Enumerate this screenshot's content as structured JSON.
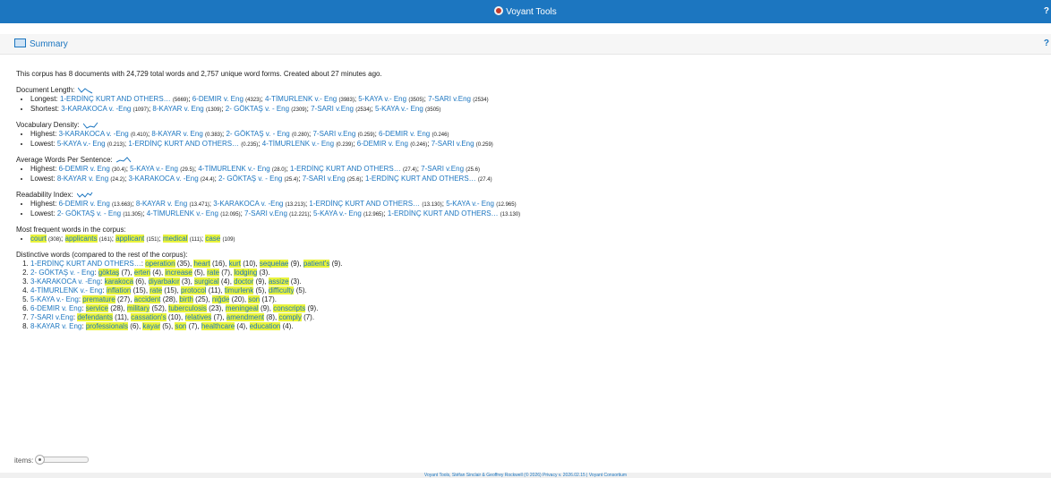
{
  "app": {
    "title": "Voyant Tools",
    "help": "?"
  },
  "panel": {
    "title": "Summary",
    "help": "?"
  },
  "summary": {
    "intro": "This corpus has 8 documents with 24,729 total words and 2,757 unique word forms. Created about 27 minutes ago.",
    "doc_length": {
      "label": "Document Length:",
      "longest_label": "Longest:",
      "longest": [
        {
          "name": "1-ERDİNÇ KURT AND OTHERS…",
          "value": "(5669)"
        },
        {
          "name": "6-DEMIR v. Eng",
          "value": "(4323)"
        },
        {
          "name": "4-TİMURLENK v.- Eng",
          "value": "(3983)"
        },
        {
          "name": "5-KAYA v.- Eng",
          "value": "(3505)"
        },
        {
          "name": "7-SARI v.Eng",
          "value": "(2534)"
        }
      ],
      "shortest_label": "Shortest:",
      "shortest": [
        {
          "name": "3-KARAKOCA v. -Eng",
          "value": "(1097)"
        },
        {
          "name": "8-KAYAR v. Eng",
          "value": "(1309)"
        },
        {
          "name": "2- GÖKTAŞ v. - Eng",
          "value": "(2309)"
        },
        {
          "name": "7-SARI v.Eng",
          "value": "(2534)"
        },
        {
          "name": "5-KAYA v.- Eng",
          "value": "(3505)"
        }
      ]
    },
    "vocab_density": {
      "label": "Vocabulary Density:",
      "highest_label": "Highest:",
      "highest": [
        {
          "name": "3-KARAKOCA v. -Eng",
          "value": "(0.410)"
        },
        {
          "name": "8-KAYAR v. Eng",
          "value": "(0.383)"
        },
        {
          "name": "2- GÖKTAŞ v. - Eng",
          "value": "(0.280)"
        },
        {
          "name": "7-SARI v.Eng",
          "value": "(0.259)"
        },
        {
          "name": "6-DEMIR v. Eng",
          "value": "(0.246)"
        }
      ],
      "lowest_label": "Lowest:",
      "lowest": [
        {
          "name": "5-KAYA v.- Eng",
          "value": "(0.213)"
        },
        {
          "name": "1-ERDİNÇ KURT AND OTHERS…",
          "value": "(0.235)"
        },
        {
          "name": "4-TİMURLENK v.- Eng",
          "value": "(0.239)"
        },
        {
          "name": "6-DEMIR v. Eng",
          "value": "(0.246)"
        },
        {
          "name": "7-SARI v.Eng",
          "value": "(0.259)"
        }
      ]
    },
    "avg_words": {
      "label": "Average Words Per Sentence:",
      "highest_label": "Highest:",
      "highest": [
        {
          "name": "6-DEMIR v. Eng",
          "value": "(30.4)"
        },
        {
          "name": "5-KAYA v.- Eng",
          "value": "(29.5)"
        },
        {
          "name": "4-TİMURLENK v.- Eng",
          "value": "(28.0)"
        },
        {
          "name": "1-ERDİNÇ KURT AND OTHERS…",
          "value": "(27.4)"
        },
        {
          "name": "7-SARI v.Eng",
          "value": "(25.6)"
        }
      ],
      "lowest_label": "Lowest:",
      "lowest": [
        {
          "name": "8-KAYAR v. Eng",
          "value": "(24.2)"
        },
        {
          "name": "3-KARAKOCA v. -Eng",
          "value": "(24.4)"
        },
        {
          "name": "2- GÖKTAŞ v. - Eng",
          "value": "(25.4)"
        },
        {
          "name": "7-SARI v.Eng",
          "value": "(25.6)"
        },
        {
          "name": "1-ERDİNÇ KURT AND OTHERS…",
          "value": "(27.4)"
        }
      ]
    },
    "readability": {
      "label": "Readability Index:",
      "highest_label": "Highest:",
      "highest": [
        {
          "name": "6-DEMIR v. Eng",
          "value": "(13.663)"
        },
        {
          "name": "8-KAYAR v. Eng",
          "value": "(13.471)"
        },
        {
          "name": "3-KARAKOCA v. -Eng",
          "value": "(13.213)"
        },
        {
          "name": "1-ERDİNÇ KURT AND OTHERS…",
          "value": "(13.130)"
        },
        {
          "name": "5-KAYA v.- Eng",
          "value": "(12.965)"
        }
      ],
      "lowest_label": "Lowest:",
      "lowest": [
        {
          "name": "2- GÖKTAŞ v. - Eng",
          "value": "(11.305)"
        },
        {
          "name": "4-TİMURLENK v.- Eng",
          "value": "(12.095)"
        },
        {
          "name": "7-SARI v.Eng",
          "value": "(12.221)"
        },
        {
          "name": "5-KAYA v.- Eng",
          "value": "(12.965)"
        },
        {
          "name": "1-ERDİNÇ KURT AND OTHERS…",
          "value": "(13.130)"
        }
      ]
    },
    "frequent": {
      "label": "Most frequent words in the corpus:",
      "words": [
        {
          "word": "court",
          "count": "(308)"
        },
        {
          "word": "applicants",
          "count": "(161)"
        },
        {
          "word": "applicant",
          "count": "(151)"
        },
        {
          "word": "medical",
          "count": "(111)"
        },
        {
          "word": "case",
          "count": "(109)"
        }
      ]
    },
    "distinctive": {
      "label": "Distinctive words (compared to the rest of the corpus):",
      "docs": [
        {
          "doc": "1-ERDİNÇ KURT AND OTHERS…",
          "words": [
            {
              "w": "operation",
              "c": "(35)"
            },
            {
              "w": "heart",
              "c": "(16)"
            },
            {
              "w": "kurt",
              "c": "(10)"
            },
            {
              "w": "sequelae",
              "c": "(9)"
            },
            {
              "w": "patient's",
              "c": "(9)"
            }
          ]
        },
        {
          "doc": "2- GÖKTAŞ v. - Eng",
          "words": [
            {
              "w": "göktaş",
              "c": "(7)"
            },
            {
              "w": "erten",
              "c": "(4)"
            },
            {
              "w": "increase",
              "c": "(5)"
            },
            {
              "w": "rate",
              "c": "(7)"
            },
            {
              "w": "lodging",
              "c": "(3)"
            }
          ]
        },
        {
          "doc": "3-KARAKOCA v. -Eng",
          "words": [
            {
              "w": "karakoca",
              "c": "(6)"
            },
            {
              "w": "diyarbakır",
              "c": "(3)"
            },
            {
              "w": "surgical",
              "c": "(4)"
            },
            {
              "w": "doctor",
              "c": "(9)"
            },
            {
              "w": "assize",
              "c": "(3)"
            }
          ]
        },
        {
          "doc": "4-TİMURLENK v.- Eng",
          "words": [
            {
              "w": "inflation",
              "c": "(15)"
            },
            {
              "w": "rate",
              "c": "(15)"
            },
            {
              "w": "protocol",
              "c": "(11)"
            },
            {
              "w": "timurlenk",
              "c": "(5)"
            },
            {
              "w": "difficulty",
              "c": "(5)"
            }
          ]
        },
        {
          "doc": "5-KAYA v.- Eng",
          "words": [
            {
              "w": "premature",
              "c": "(27)"
            },
            {
              "w": "accident",
              "c": "(28)"
            },
            {
              "w": "birth",
              "c": "(25)"
            },
            {
              "w": "niğde",
              "c": "(20)"
            },
            {
              "w": "son",
              "c": "(17)"
            }
          ]
        },
        {
          "doc": "6-DEMIR v. Eng",
          "words": [
            {
              "w": "service",
              "c": "(28)"
            },
            {
              "w": "military",
              "c": "(52)"
            },
            {
              "w": "tuberculosis",
              "c": "(23)"
            },
            {
              "w": "meningeal",
              "c": "(9)"
            },
            {
              "w": "conscripts",
              "c": "(9)"
            }
          ]
        },
        {
          "doc": "7-SARI v.Eng",
          "words": [
            {
              "w": "defendants",
              "c": "(11)"
            },
            {
              "w": "cassation's",
              "c": "(10)"
            },
            {
              "w": "relatives",
              "c": "(7)"
            },
            {
              "w": "amendment",
              "c": "(8)"
            },
            {
              "w": "comply",
              "c": "(7)"
            }
          ]
        },
        {
          "doc": "8-KAYAR v. Eng",
          "words": [
            {
              "w": "professionals",
              "c": "(6)"
            },
            {
              "w": "kayar",
              "c": "(5)"
            },
            {
              "w": "son",
              "c": "(7)"
            },
            {
              "w": "healthcare",
              "c": "(4)"
            },
            {
              "w": "education",
              "c": "(4)"
            }
          ]
        }
      ]
    }
  },
  "items_label": "items:",
  "items_level": 0,
  "footer": "Voyant Tools, Stéfan Sinclair & Geoffrey Rockwell (© 2026) Privacy v. 2026.02.15 | Voyant Consortium",
  "colors": {
    "accent": "#1c76c0",
    "highlight": "#e9f33a"
  }
}
